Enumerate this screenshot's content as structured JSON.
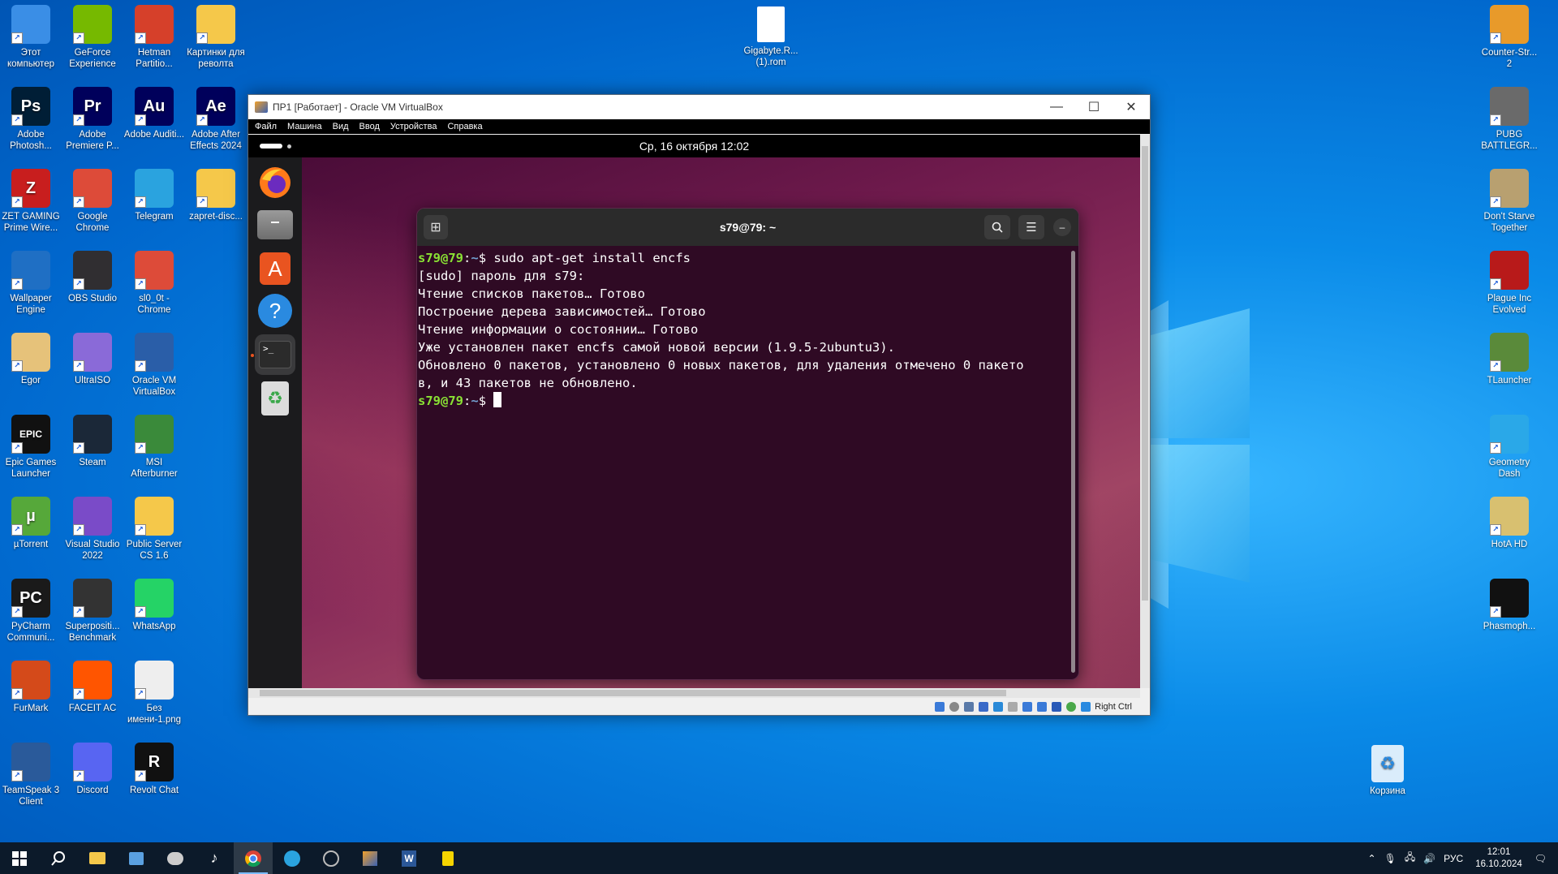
{
  "desktop": {
    "left_icons": [
      {
        "label": "Этот компьютер",
        "icon": "computer-icon",
        "color": "#3a8ee6"
      },
      {
        "label": "GeForce Experience",
        "icon": "nvidia-icon",
        "color": "#76b900"
      },
      {
        "label": "Hetman Partitio...",
        "icon": "hetman-icon",
        "color": "#d6402a"
      },
      {
        "label": "Картинки для револта",
        "icon": "folder-icon",
        "color": "#f5c84a"
      },
      {
        "label": "Adobe Photosh...",
        "icon": "photoshop-icon",
        "color": "#001e36",
        "glyph": "Ps"
      },
      {
        "label": "Adobe Premiere P...",
        "icon": "premiere-icon",
        "color": "#00005b",
        "glyph": "Pr"
      },
      {
        "label": "Adobe Auditi...",
        "icon": "audition-icon",
        "color": "#00005b",
        "glyph": "Au"
      },
      {
        "label": "Adobe After Effects 2024",
        "icon": "after-effects-icon",
        "color": "#00005b",
        "glyph": "Ae"
      },
      {
        "label": "ZET GAMING Prime Wire...",
        "icon": "zet-gaming-icon",
        "color": "#c81e1e",
        "glyph": "Z"
      },
      {
        "label": "Google Chrome",
        "icon": "chrome-icon",
        "color": "#dd4b39"
      },
      {
        "label": "Telegram",
        "icon": "telegram-icon",
        "color": "#2aa3df"
      },
      {
        "label": "zapret-disc...",
        "icon": "folder-icon",
        "color": "#f5c84a"
      },
      {
        "label": "Wallpaper Engine",
        "icon": "wallpaper-engine-icon",
        "color": "#1f6fc4"
      },
      {
        "label": "OBS Studio",
        "icon": "obs-icon",
        "color": "#302e31"
      },
      {
        "label": "sl0_0t - Chrome",
        "icon": "chrome-profile-icon",
        "color": "#dd4b39"
      },
      {
        "label": "Egor",
        "icon": "folder-icon",
        "color": "#e6c27a"
      },
      {
        "label": "UltraISO",
        "icon": "ultraiso-icon",
        "color": "#8a6ad8"
      },
      {
        "label": "Oracle VM VirtualBox",
        "icon": "virtualbox-icon",
        "color": "#2a5ea8"
      },
      {
        "label": "Epic Games Launcher",
        "icon": "epic-games-icon",
        "color": "#111111",
        "glyph": "EPIC"
      },
      {
        "label": "Steam",
        "icon": "steam-icon",
        "color": "#1b2838"
      },
      {
        "label": "MSI Afterburner",
        "icon": "msi-afterburner-icon",
        "color": "#3a8a3a"
      },
      {
        "label": "µTorrent",
        "icon": "utorrent-icon",
        "color": "#56a83a",
        "glyph": "µ"
      },
      {
        "label": "Visual Studio 2022",
        "icon": "visual-studio-icon",
        "color": "#7a4bc8"
      },
      {
        "label": "Public Server CS 1.6",
        "icon": "folder-icon",
        "color": "#f5c84a"
      },
      {
        "label": "PyCharm Communi...",
        "icon": "pycharm-icon",
        "color": "#1a1a1a",
        "glyph": "PC"
      },
      {
        "label": "Superpositi... Benchmark",
        "icon": "superposition-icon",
        "color": "#333333"
      },
      {
        "label": "WhatsApp",
        "icon": "whatsapp-icon",
        "color": "#25d366"
      },
      {
        "label": "FurMark",
        "icon": "furmark-icon",
        "color": "#d44a1a"
      },
      {
        "label": "FACEIT AC",
        "icon": "faceit-icon",
        "color": "#ff5500"
      },
      {
        "label": "Без имени-1.png",
        "icon": "image-file-icon",
        "color": "#eeeeee"
      },
      {
        "label": "TeamSpeak 3 Client",
        "icon": "teamspeak-icon",
        "color": "#2a5a9a"
      },
      {
        "label": "Discord",
        "icon": "discord-icon",
        "color": "#5865f2"
      },
      {
        "label": "Revolt Chat",
        "icon": "revolt-icon",
        "color": "#111111",
        "glyph": "R"
      }
    ],
    "top_file": {
      "label": "Gigabyte.R... (1).rom",
      "icon": "file-icon"
    },
    "right_icons": [
      {
        "label": "Counter-Str... 2",
        "icon": "counter-strike-icon",
        "color": "#e89a2a"
      },
      {
        "label": "PUBG BATTLEGR...",
        "icon": "pubg-icon",
        "color": "#6a6a6a"
      },
      {
        "label": "Don't Starve Together",
        "icon": "dont-starve-icon",
        "color": "#b8a070"
      },
      {
        "label": "Plague Inc Evolved",
        "icon": "plague-inc-icon",
        "color": "#b81a1a"
      },
      {
        "label": "TLauncher",
        "icon": "tlauncher-icon",
        "color": "#5a8a3a"
      },
      {
        "label": "Geometry Dash",
        "icon": "geometry-dash-icon",
        "color": "#2aa8e8"
      },
      {
        "label": "HotA HD",
        "icon": "hota-icon",
        "color": "#d8c070"
      },
      {
        "label": "Phasmoph...",
        "icon": "phasmophobia-icon",
        "color": "#111111"
      }
    ],
    "recycle_bin": {
      "label": "Корзина",
      "icon": "recycle-bin-icon"
    }
  },
  "vbox": {
    "title": "ПР1 [Работает] - Oracle VM VirtualBox",
    "menu": [
      "Файл",
      "Машина",
      "Вид",
      "Ввод",
      "Устройства",
      "Справка"
    ],
    "host_key": "Right Ctrl",
    "guest": {
      "clock": "Ср, 16 октября  12:02",
      "dock": [
        "firefox-icon",
        "files-icon",
        "app-center-icon",
        "help-icon",
        "terminal-icon",
        "trash-icon"
      ],
      "terminal": {
        "title": "s79@79: ~",
        "lines": [
          {
            "user": "s79@79",
            "dir": "~",
            "cmd": "sudo apt-get install encfs"
          },
          {
            "text": "[sudo] пароль для s79:"
          },
          {
            "text": "Чтение списков пакетов… Готово"
          },
          {
            "text": "Построение дерева зависимостей… Готово"
          },
          {
            "text": "Чтение информации о состоянии… Готово"
          },
          {
            "text": "Уже установлен пакет encfs самой новой версии (1.9.5-2ubuntu3)."
          },
          {
            "text": "Обновлено 0 пакетов, установлено 0 новых пакетов, для удаления отмечено 0 пакето"
          },
          {
            "text": "в, и 43 пакетов не обновлено."
          },
          {
            "user": "s79@79",
            "dir": "~",
            "cmd": ""
          }
        ]
      }
    }
  },
  "taskbar": {
    "lang": "РУС",
    "time": "12:01",
    "date": "16.10.2024"
  }
}
